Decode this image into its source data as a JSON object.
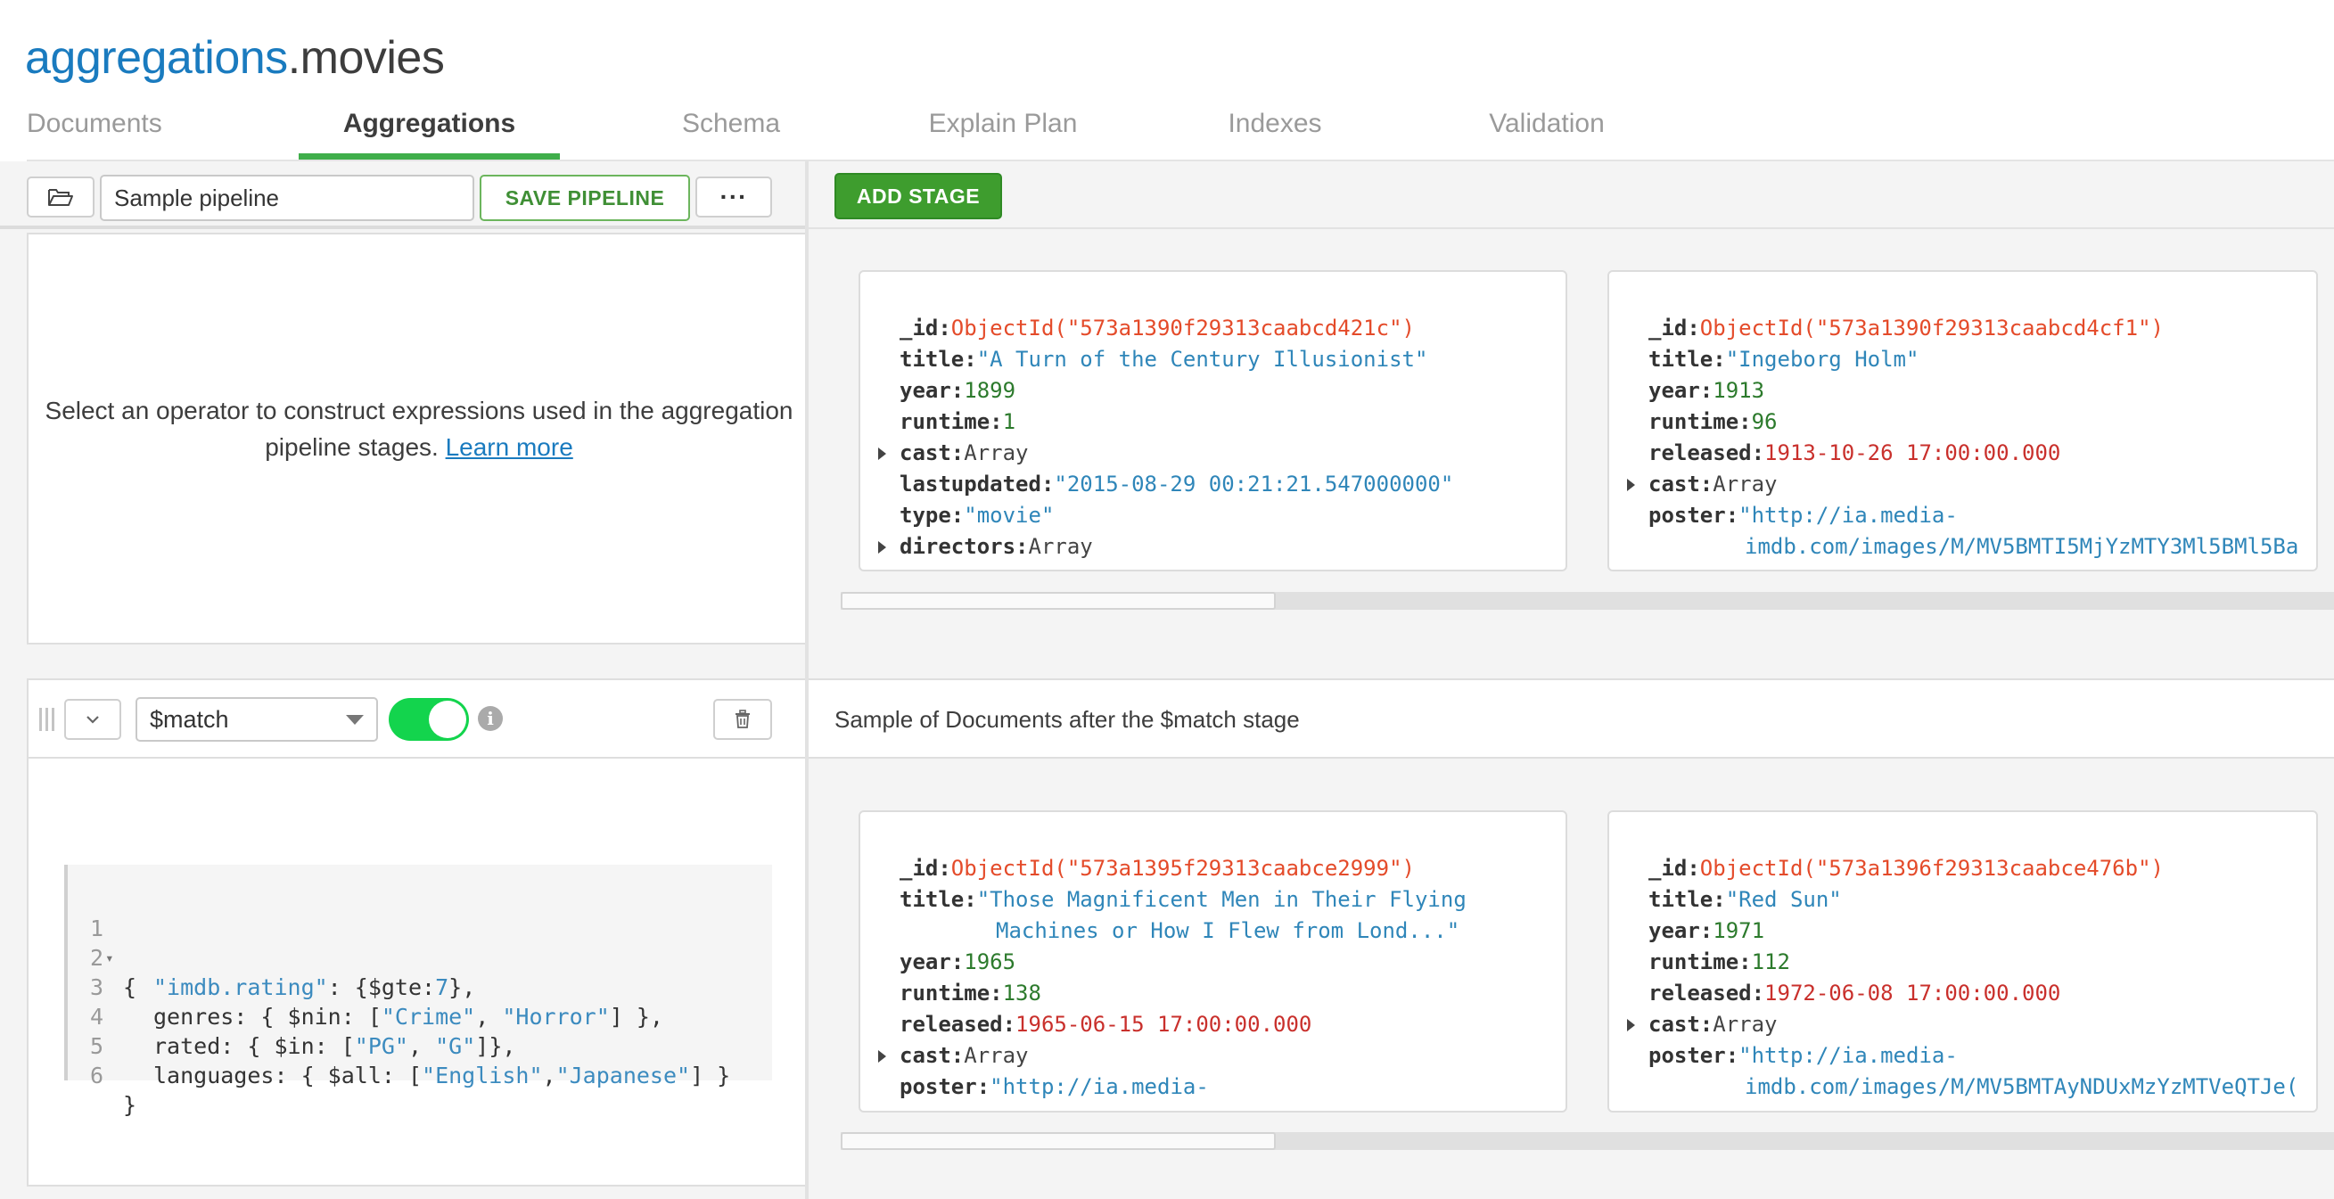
{
  "header": {
    "db": "aggregations",
    "sep_collection": ".movies"
  },
  "tabs": [
    {
      "label": "Documents"
    },
    {
      "label": "Aggregations"
    },
    {
      "label": "Schema"
    },
    {
      "label": "Explain Plan"
    },
    {
      "label": "Indexes"
    },
    {
      "label": "Validation"
    }
  ],
  "active_tab": "Aggregations",
  "toolbar": {
    "folder_icon": "folder-open-icon",
    "pipeline_name": "Sample pipeline",
    "save_label": "SAVE PIPELINE",
    "more_label": "···",
    "add_stage_label": "ADD STAGE"
  },
  "info_panel": {
    "text": "Select an operator to construct expressions used in the aggregation pipeline stages.",
    "link": "Learn more"
  },
  "stage": {
    "collapse_icon": "chevron-down-icon",
    "operator": "$match",
    "enabled": true,
    "info_icon": "i",
    "delete_icon": "trash-icon",
    "description": "Sample of Documents after the $match stage",
    "code": {
      "line_numbers": [
        "1",
        "2",
        "3",
        "4",
        "5",
        "6"
      ],
      "l1": "{",
      "l2_key": "\"imdb.rating\"",
      "l2_rest": ": {$gte:",
      "l2_num": "7",
      "l2_end": "},",
      "l3_a": "genres: { $nin: [",
      "l3_s1": "\"Crime\"",
      "l3_comma": ", ",
      "l3_s2": "\"Horror\"",
      "l3_end": "] },",
      "l4_a": "rated: { $in: [",
      "l4_s1": "\"PG\"",
      "l4_comma": ", ",
      "l4_s2": "\"G\"",
      "l4_end": "]},",
      "l5_a": "languages: { $all: [",
      "l5_s1": "\"English\"",
      "l5_comma": ",",
      "l5_s2": "\"Japanese\"",
      "l5_end": "] }",
      "l6": "}"
    }
  },
  "preview_top": [
    {
      "id_key": "_id:",
      "id": "ObjectId(\"573a1390f29313caabcd421c\")",
      "title_key": "title:",
      "title": "\"A Turn of the Century Illusionist\"",
      "year_key": "year:",
      "year": "1899",
      "runtime_key": "runtime:",
      "runtime": "1",
      "cast_key": "cast:",
      "cast": "Array",
      "lastupdated_key": "lastupdated:",
      "lastupdated": "\"2015-08-29 00:21:21.547000000\"",
      "type_key": "type:",
      "type": "\"movie\"",
      "directors_key": "directors:",
      "directors": "Array"
    },
    {
      "id_key": "_id:",
      "id": "ObjectId(\"573a1390f29313caabcd4cf1\")",
      "title_key": "title:",
      "title": "\"Ingeborg Holm\"",
      "year_key": "year:",
      "year": "1913",
      "runtime_key": "runtime:",
      "runtime": "96",
      "released_key": "released:",
      "released": "1913-10-26 17:00:00.000",
      "cast_key": "cast:",
      "cast": "Array",
      "poster_key": "poster:",
      "poster_1": "\"http://ia.media-",
      "poster_2": "imdb.com/images/M/MV5BMTI5MjYzMTY3Ml5BMl5Ba"
    }
  ],
  "preview_bottom": [
    {
      "id_key": "_id:",
      "id": "ObjectId(\"573a1395f29313caabce2999\")",
      "title_key": "title:",
      "title_1": "\"Those Magnificent Men in Their Flying",
      "title_2": "Machines or How I Flew from Lond...\"",
      "year_key": "year:",
      "year": "1965",
      "runtime_key": "runtime:",
      "runtime": "138",
      "released_key": "released:",
      "released": "1965-06-15 17:00:00.000",
      "cast_key": "cast:",
      "cast": "Array",
      "poster_key": "poster:",
      "poster_1": "\"http://ia.media-"
    },
    {
      "id_key": "_id:",
      "id": "ObjectId(\"573a1396f29313caabce476b\")",
      "title_key": "title:",
      "title": "\"Red Sun\"",
      "year_key": "year:",
      "year": "1971",
      "runtime_key": "runtime:",
      "runtime": "112",
      "released_key": "released:",
      "released": "1972-06-08 17:00:00.000",
      "cast_key": "cast:",
      "cast": "Array",
      "poster_key": "poster:",
      "poster_1": "\"http://ia.media-",
      "poster_2": "imdb.com/images/M/MV5BMTAyNDUxMzYzMTVeQTJe("
    }
  ],
  "colors": {
    "accent_green": "#3fae4a",
    "add_stage_green": "#3e9d2e",
    "toggle_on": "#13d44d",
    "db_link_blue": "#1a7bbf",
    "objectid_red": "#e44b2a",
    "date_red": "#c9302c",
    "string_blue": "#2f86b9",
    "number_green": "#2c7a2c"
  }
}
